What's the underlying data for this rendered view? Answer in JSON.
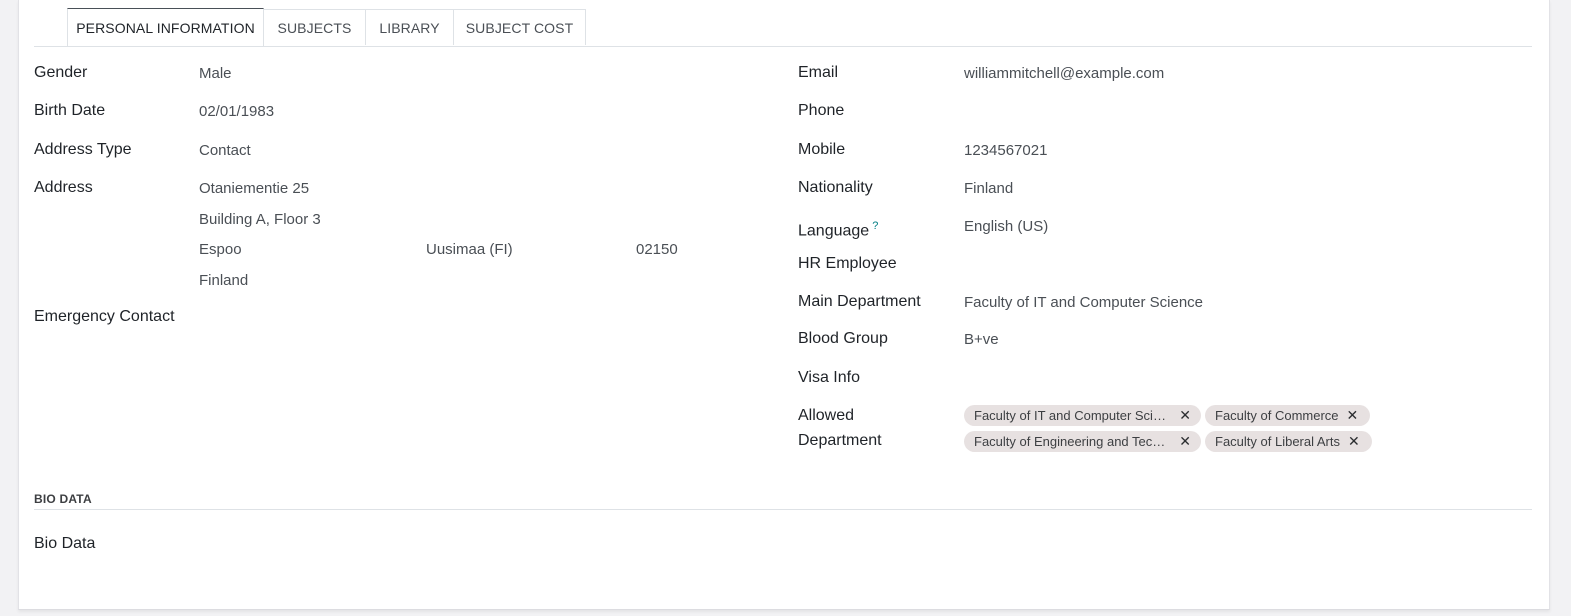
{
  "tabs": [
    {
      "label": "PERSONAL INFORMATION"
    },
    {
      "label": "SUBJECTS"
    },
    {
      "label": "LIBRARY"
    },
    {
      "label": "SUBJECT COST"
    }
  ],
  "left": {
    "gender": {
      "label": "Gender",
      "value": "Male"
    },
    "birth_date": {
      "label": "Birth Date",
      "value": "02/01/1983"
    },
    "address_type": {
      "label": "Address Type",
      "value": "Contact"
    },
    "address": {
      "label": "Address",
      "street": "Otaniementie 25",
      "street2": "Building A, Floor 3",
      "city": "Espoo",
      "state": "Uusimaa (FI)",
      "zip": "02150",
      "country": "Finland"
    },
    "emergency_contact": {
      "label": "Emergency Contact",
      "value": ""
    }
  },
  "right": {
    "email": {
      "label": "Email",
      "value": "williammitchell@example.com"
    },
    "phone": {
      "label": "Phone",
      "value": ""
    },
    "mobile": {
      "label": "Mobile",
      "value": "1234567021"
    },
    "nationality": {
      "label": "Nationality",
      "value": "Finland"
    },
    "language": {
      "label": "Language",
      "help": "?",
      "value": "English (US)"
    },
    "hr_employee": {
      "label": "HR Employee",
      "value": ""
    },
    "main_department": {
      "label": "Main Department",
      "value": "Faculty of IT and Computer Science"
    },
    "blood_group": {
      "label": "Blood Group",
      "value": "B+ve"
    },
    "visa_info": {
      "label": "Visa Info",
      "value": ""
    },
    "allowed_department": {
      "label_line1": "Allowed",
      "label_line2": "Department",
      "tags": [
        {
          "label": "Faculty of IT and Computer Science"
        },
        {
          "label": "Faculty of Commerce"
        },
        {
          "label": "Faculty of Engineering and Technology"
        },
        {
          "label": "Faculty of Liberal Arts"
        }
      ],
      "remove_glyph": "✕"
    }
  },
  "bio": {
    "section_title": "BIO DATA",
    "label": "Bio Data",
    "value": ""
  }
}
